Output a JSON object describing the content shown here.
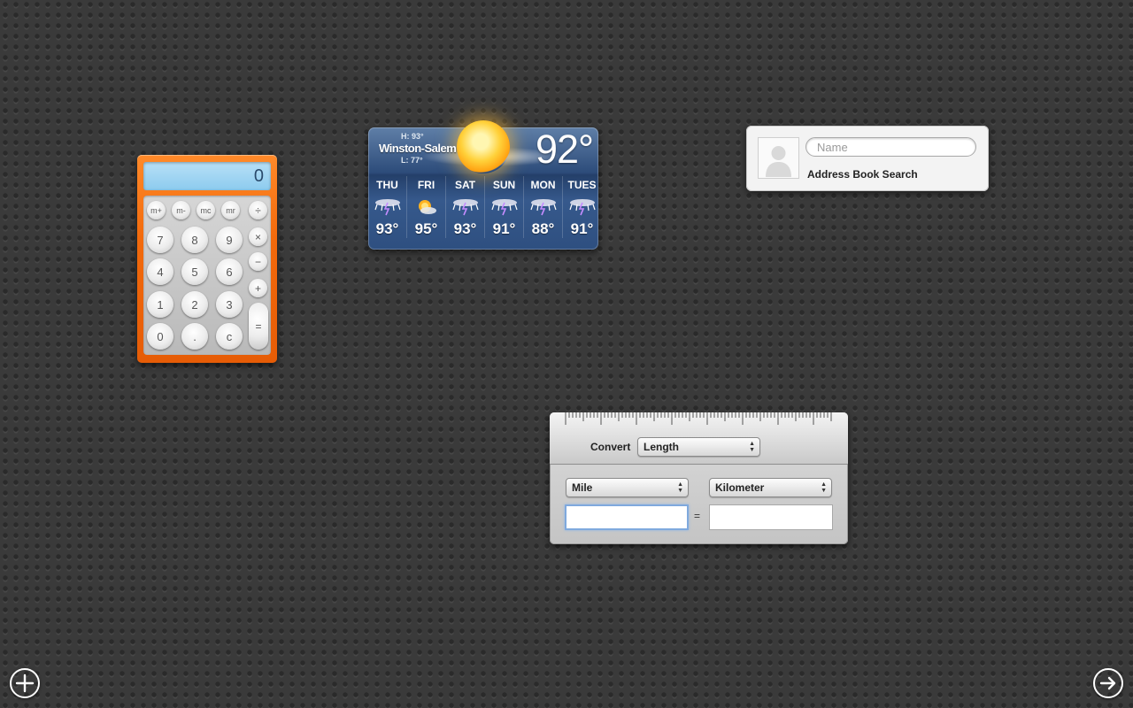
{
  "calculator": {
    "display": "0",
    "memory_keys": [
      "m+",
      "m-",
      "mc",
      "mr"
    ],
    "digit_rows": [
      [
        "7",
        "8",
        "9"
      ],
      [
        "4",
        "5",
        "6"
      ],
      [
        "1",
        "2",
        "3"
      ],
      [
        "0",
        ".",
        "c"
      ]
    ],
    "op_keys": [
      "÷",
      "×",
      "−",
      "+"
    ],
    "equals": "="
  },
  "weather": {
    "city": "Winston-Salem",
    "high": "H: 93°",
    "low": "L: 77°",
    "current_temp": "92°",
    "current_icon": "sun-icon",
    "days": [
      {
        "name": "THU",
        "temp": "93°",
        "icon": "thunderstorm-icon"
      },
      {
        "name": "FRI",
        "temp": "95°",
        "icon": "partly-sunny-icon"
      },
      {
        "name": "SAT",
        "temp": "93°",
        "icon": "thunderstorm-icon"
      },
      {
        "name": "SUN",
        "temp": "91°",
        "icon": "thunderstorm-icon"
      },
      {
        "name": "MON",
        "temp": "88°",
        "icon": "thunderstorm-icon"
      },
      {
        "name": "TUES",
        "temp": "91°",
        "icon": "thunderstorm-icon"
      }
    ]
  },
  "address_book": {
    "name_placeholder": "Name",
    "title": "Address Book Search"
  },
  "converter": {
    "convert_label": "Convert",
    "type": "Length",
    "from_unit": "Mile",
    "to_unit": "Kilometer",
    "from_value": "",
    "to_value": "",
    "equals": "="
  },
  "dashboard": {
    "add_icon": "plus-circle-icon",
    "next_icon": "arrow-right-circle-icon"
  }
}
